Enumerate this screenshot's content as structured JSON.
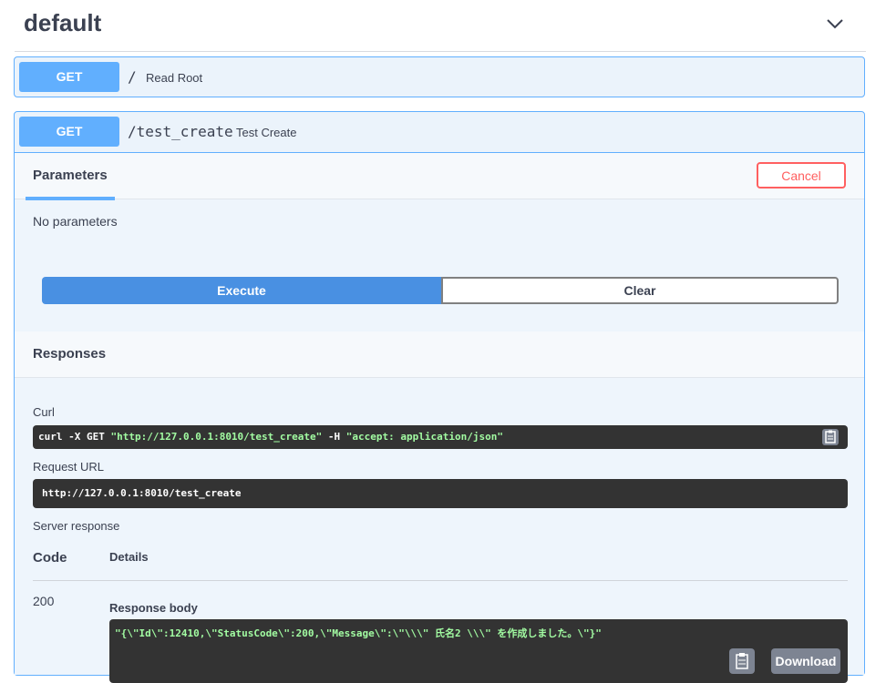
{
  "tag": {
    "title": "default",
    "toggle_icon": "chevron-down-icon"
  },
  "operations": [
    {
      "method": "GET",
      "path": "/",
      "description": "Read Root"
    },
    {
      "method": "GET",
      "path": "/test_create",
      "description": "Test Create"
    }
  ],
  "parameters": {
    "tab_label": "Parameters",
    "cancel_label": "Cancel",
    "empty_text": "No parameters"
  },
  "actions": {
    "execute_label": "Execute",
    "clear_label": "Clear"
  },
  "responses": {
    "title": "Responses",
    "curl_label": "Curl",
    "curl_parts": [
      "curl -X GET ",
      "\"http://127.0.0.1:8010/test_create\"",
      " -H  ",
      "\"accept: application/json\""
    ],
    "request_url_label": "Request URL",
    "request_url": "http://127.0.0.1:8010/test_create",
    "server_response_label": "Server response",
    "code_header": "Code",
    "details_header": "Details",
    "status_code": "200",
    "body_label": "Response body",
    "body": "\"{\\\"Id\\\":12410,\\\"StatusCode\\\":200,\\\"Message\\\":\\\"\\\\\\\" 氏名2 \\\\\\\" を作成しました。\\\"}\"",
    "download_label": "Download"
  },
  "colors": {
    "get": "#61affe",
    "execute": "#4990e2",
    "cancel": "#ff6060",
    "code_bg": "#333333",
    "code_string": "#a2fca2"
  }
}
